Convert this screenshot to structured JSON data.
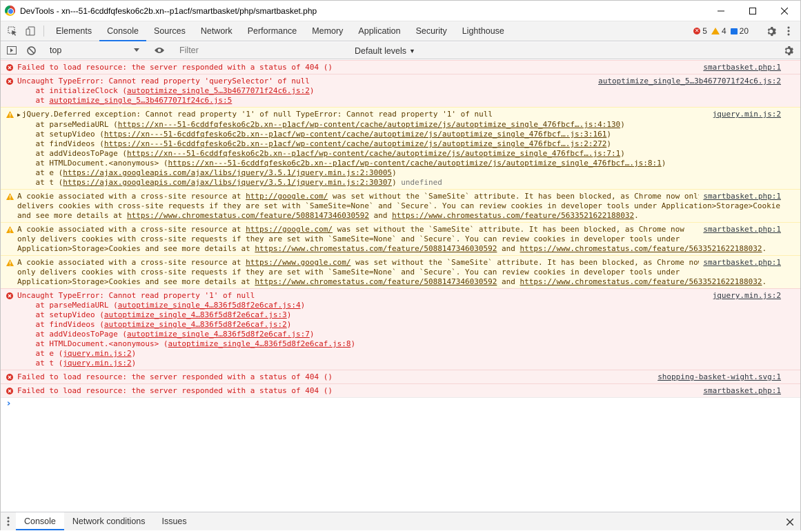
{
  "window": {
    "title": "DevTools - xn---51-6cddfqfesko6c2b.xn--p1acf/smartbasket/php/smartbasket.php"
  },
  "tabs": [
    {
      "label": "Elements"
    },
    {
      "label": "Console"
    },
    {
      "label": "Sources"
    },
    {
      "label": "Network"
    },
    {
      "label": "Performance"
    },
    {
      "label": "Memory"
    },
    {
      "label": "Application"
    },
    {
      "label": "Security"
    },
    {
      "label": "Lighthouse"
    }
  ],
  "counters": {
    "errors": "5",
    "warnings": "4",
    "messages": "20"
  },
  "console_toolbar": {
    "context": "top",
    "filter_placeholder": "Filter",
    "levels": "Default levels"
  },
  "messages": [
    {
      "type": "error",
      "source": "smartbasket.php:1",
      "text": "Failed to load resource: the server responded with a status of 404 ()"
    },
    {
      "type": "error",
      "source": "autoptimize_single_5…3b4677071f24c6.js:2",
      "text": "Uncaught TypeError: Cannot read property 'querySelector' of null",
      "stack": [
        {
          "fn": "    at initializeClock (",
          "link": "autoptimize_single_5…3b4677071f24c6.js:2",
          "tail": ")"
        },
        {
          "fn": "    at ",
          "link": "autoptimize_single_5…3b4677071f24c6.js:5",
          "tail": ""
        }
      ]
    },
    {
      "type": "warning",
      "source": "jquery.min.js:2",
      "text": "jQuery.Deferred exception: Cannot read property '1' of null TypeError: Cannot read property '1' of null",
      "stack": [
        {
          "fn": "    at parseMediaURL (",
          "link": "https://xn---51-6cddfqfesko6c2b.xn--p1acf/wp-content/cache/autoptimize/js/autoptimize_single_476fbcf….js:4:130",
          "tail": ")"
        },
        {
          "fn": "    at setupVideo (",
          "link": "https://xn---51-6cddfqfesko6c2b.xn--p1acf/wp-content/cache/autoptimize/js/autoptimize_single_476fbcf….js:3:161",
          "tail": ")"
        },
        {
          "fn": "    at findVideos (",
          "link": "https://xn---51-6cddfqfesko6c2b.xn--p1acf/wp-content/cache/autoptimize/js/autoptimize_single_476fbcf….js:2:272",
          "tail": ")"
        },
        {
          "fn": "    at addVideosToPage (",
          "link": "https://xn---51-6cddfqfesko6c2b.xn--p1acf/wp-content/cache/autoptimize/js/autoptimize_single_476fbcf….js:7:1",
          "tail": ")"
        },
        {
          "fn": "    at HTMLDocument.<anonymous> (",
          "link": "https://xn---51-6cddfqfesko6c2b.xn--p1acf/wp-content/cache/autoptimize/js/autoptimize_single_476fbcf….js:8:1",
          "tail": ")"
        },
        {
          "fn": "    at e (",
          "link": "https://ajax.googleapis.com/ajax/libs/jquery/3.5.1/jquery.min.js:2:30005",
          "tail": ")"
        },
        {
          "fn": "    at t (",
          "link": "https://ajax.googleapis.com/ajax/libs/jquery/3.5.1/jquery.min.js:2:30307",
          "tail": ")",
          "extra": " undefined"
        }
      ]
    },
    {
      "type": "warning",
      "source": "smartbasket.php:1",
      "parts": [
        [
          "A cookie associated with a cross-site resource at ",
          "http://google.com/",
          " was set without the `SameSite` attribute. It has been blocked, as Chrome now only"
        ],
        [
          "delivers cookies with cross-site requests if they are set with `SameSite=None` and `Secure`. You can review cookies in developer tools under Application>Storage>Cookies"
        ],
        [
          "and see more details at ",
          "https://www.chromestatus.com/feature/5088147346030592",
          " and ",
          "https://www.chromestatus.com/feature/5633521622188032",
          "."
        ]
      ]
    },
    {
      "type": "warning",
      "source": "smartbasket.php:1",
      "parts": [
        [
          "A cookie associated with a cross-site resource at ",
          "https://google.com/",
          " was set without the `SameSite` attribute. It has been blocked, as Chrome now"
        ],
        [
          "only delivers cookies with cross-site requests if they are set with `SameSite=None` and `Secure`. You can review cookies in developer tools under"
        ],
        [
          "Application>Storage>Cookies and see more details at ",
          "https://www.chromestatus.com/feature/5088147346030592",
          " and ",
          "https://www.chromestatus.com/feature/5633521622188032",
          "."
        ]
      ]
    },
    {
      "type": "warning",
      "source": "smartbasket.php:1",
      "parts": [
        [
          "A cookie associated with a cross-site resource at ",
          "https://www.google.com/",
          " was set without the `SameSite` attribute. It has been blocked, as Chrome now"
        ],
        [
          "only delivers cookies with cross-site requests if they are set with `SameSite=None` and `Secure`. You can review cookies in developer tools under"
        ],
        [
          "Application>Storage>Cookies and see more details at ",
          "https://www.chromestatus.com/feature/5088147346030592",
          " and ",
          "https://www.chromestatus.com/feature/5633521622188032",
          "."
        ]
      ]
    },
    {
      "type": "error",
      "source": "jquery.min.js:2",
      "text": "Uncaught TypeError: Cannot read property '1' of null",
      "stack": [
        {
          "fn": "    at parseMediaURL (",
          "link": "autoptimize_single_4…836f5d8f2e6caf.js:4",
          "tail": ")"
        },
        {
          "fn": "    at setupVideo (",
          "link": "autoptimize_single_4…836f5d8f2e6caf.js:3",
          "tail": ")"
        },
        {
          "fn": "    at findVideos (",
          "link": "autoptimize_single_4…836f5d8f2e6caf.js:2",
          "tail": ")"
        },
        {
          "fn": "    at addVideosToPage (",
          "link": "autoptimize_single_4…836f5d8f2e6caf.js:7",
          "tail": ")"
        },
        {
          "fn": "    at HTMLDocument.<anonymous> (",
          "link": "autoptimize_single_4…836f5d8f2e6caf.js:8",
          "tail": ")"
        },
        {
          "fn": "    at e (",
          "link": "jquery.min.js:2",
          "tail": ")"
        },
        {
          "fn": "    at t (",
          "link": "jquery.min.js:2",
          "tail": ")"
        }
      ]
    },
    {
      "type": "error",
      "source": "shopping-basket-wight.svg:1",
      "text": "Failed to load resource: the server responded with a status of 404 ()"
    },
    {
      "type": "error",
      "source": "smartbasket.php:1",
      "text": "Failed to load resource: the server responded with a status of 404 ()"
    }
  ],
  "drawer": {
    "tabs": [
      {
        "label": "Console"
      },
      {
        "label": "Network conditions"
      },
      {
        "label": "Issues"
      }
    ]
  },
  "colors": {
    "accent": "#1a73e8",
    "error": "#d93025",
    "warning": "#f2a600"
  }
}
